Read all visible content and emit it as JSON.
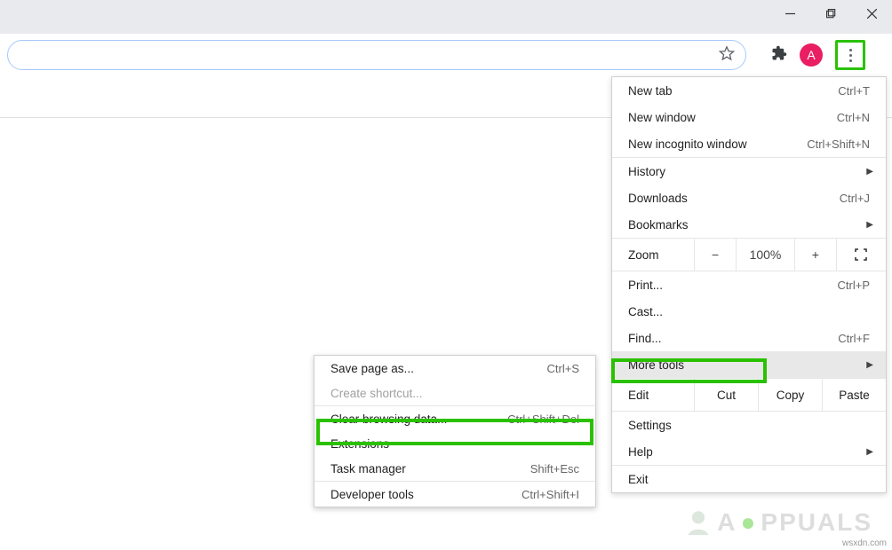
{
  "avatar": {
    "letter": "A"
  },
  "menu": {
    "new_tab": "New tab",
    "new_tab_sc": "Ctrl+T",
    "new_window": "New window",
    "new_window_sc": "Ctrl+N",
    "incognito": "New incognito window",
    "incognito_sc": "Ctrl+Shift+N",
    "history": "History",
    "downloads": "Downloads",
    "downloads_sc": "Ctrl+J",
    "bookmarks": "Bookmarks",
    "zoom_label": "Zoom",
    "zoom_minus": "−",
    "zoom_value": "100%",
    "zoom_plus": "+",
    "print": "Print...",
    "print_sc": "Ctrl+P",
    "cast": "Cast...",
    "find": "Find...",
    "find_sc": "Ctrl+F",
    "more_tools": "More tools",
    "edit_label": "Edit",
    "cut": "Cut",
    "copy": "Copy",
    "paste": "Paste",
    "settings": "Settings",
    "help": "Help",
    "exit": "Exit"
  },
  "submenu": {
    "save_page": "Save page as...",
    "save_page_sc": "Ctrl+S",
    "create_shortcut": "Create shortcut...",
    "clear_data": "Clear browsing data...",
    "clear_data_sc": "Ctrl+Shift+Del",
    "extensions": "Extensions",
    "task_manager": "Task manager",
    "task_manager_sc": "Shift+Esc",
    "dev_tools": "Developer tools",
    "dev_tools_sc": "Ctrl+Shift+I"
  },
  "watermark": "PPUALS",
  "attribution": "wsxdn.com"
}
